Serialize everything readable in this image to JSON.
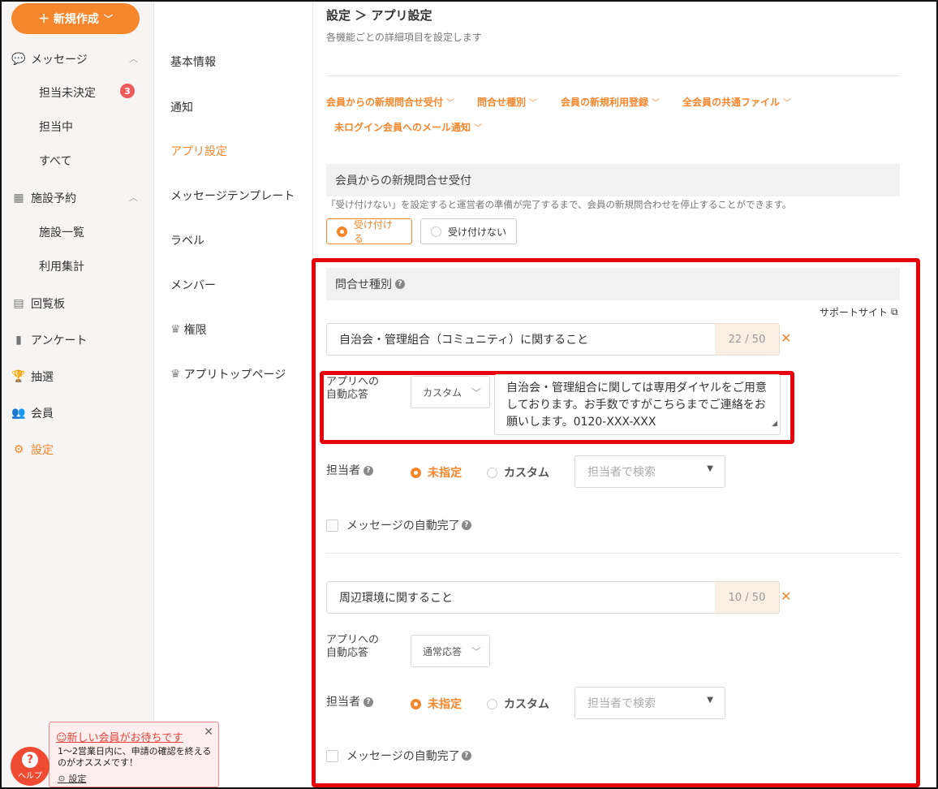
{
  "sidebar": {
    "new_button": "＋ 新規作成",
    "nav": [
      {
        "label": "メッセージ",
        "icon": "chat-icon"
      },
      {
        "label": "担当未決定",
        "badge": "3"
      },
      {
        "label": "担当中"
      },
      {
        "label": "すべて"
      },
      {
        "label": "施設予約",
        "icon": "calendar-icon"
      },
      {
        "label": "施設一覧"
      },
      {
        "label": "利用集計"
      },
      {
        "label": "回覧板",
        "icon": "board-icon"
      },
      {
        "label": "アンケート",
        "icon": "clipboard-icon"
      },
      {
        "label": "抽選",
        "icon": "trophy-icon"
      },
      {
        "label": "会員",
        "icon": "users-icon"
      },
      {
        "label": "設定",
        "icon": "gear-icon"
      }
    ]
  },
  "settings_menu": [
    "基本情報",
    "通知",
    "アプリ設定",
    "メッセージテンプレート",
    "ラベル",
    "メンバー",
    "権限",
    "アプリトップページ"
  ],
  "header": {
    "breadcrumb": "設定 ＞ アプリ設定",
    "subtitle": "各機能ごとの詳細項目を設定します"
  },
  "tabs": [
    "会員からの新規問合せ受付",
    "問合せ種別",
    "会員の新規利用登録",
    "全会員の共通ファイル",
    "未ログイン会員へのメール通知"
  ],
  "accept_section": {
    "title": "会員からの新規問合せ受付",
    "note": "「受け付けない」を設定すると運営者の準備が完了するまで、会員の新規問合わせを停止することができます。",
    "options": [
      "受け付ける",
      "受け付けない"
    ],
    "selected": "受け付ける"
  },
  "inquiry_section": {
    "title": "問合せ種別",
    "support_link": "サポートサイト",
    "items": [
      {
        "name": "自治会・管理組合（コミュニティ）に関すること",
        "counter": "22 / 50",
        "auto_reply_label": "アプリへの\n自動応答",
        "auto_reply_mode": "カスタム",
        "auto_reply_text": "自治会・管理組合に関しては専用ダイヤルをご用意しております。お手数ですがこちらまでご連絡をお願いします。0120-XXX-XXX",
        "assignee_label": "担当者",
        "assignee_options": [
          "未指定",
          "カスタム"
        ],
        "assignee_selected": "未指定",
        "assignee_search_placeholder": "担当者で検索",
        "auto_complete_label": "メッセージの自動完了"
      },
      {
        "name": "周辺環境に関すること",
        "counter": "10 / 50",
        "auto_reply_label": "アプリへの\n自動応答",
        "auto_reply_mode": "通常応答",
        "assignee_label": "担当者",
        "assignee_options": [
          "未指定",
          "カスタム"
        ],
        "assignee_selected": "未指定",
        "assignee_search_placeholder": "担当者で検索",
        "auto_complete_label": "メッセージの自動完了"
      }
    ]
  },
  "toast": {
    "title": "☺新しい会員がお待ちです",
    "body": "1〜2営業日内に、申請の確認を終えるのがオススメです！",
    "link": "設定"
  },
  "help_button": {
    "label": "ヘルプ"
  },
  "colors": {
    "accent": "#f6862b",
    "highlight": "#e8000b",
    "badge": "#ef5b5b"
  }
}
